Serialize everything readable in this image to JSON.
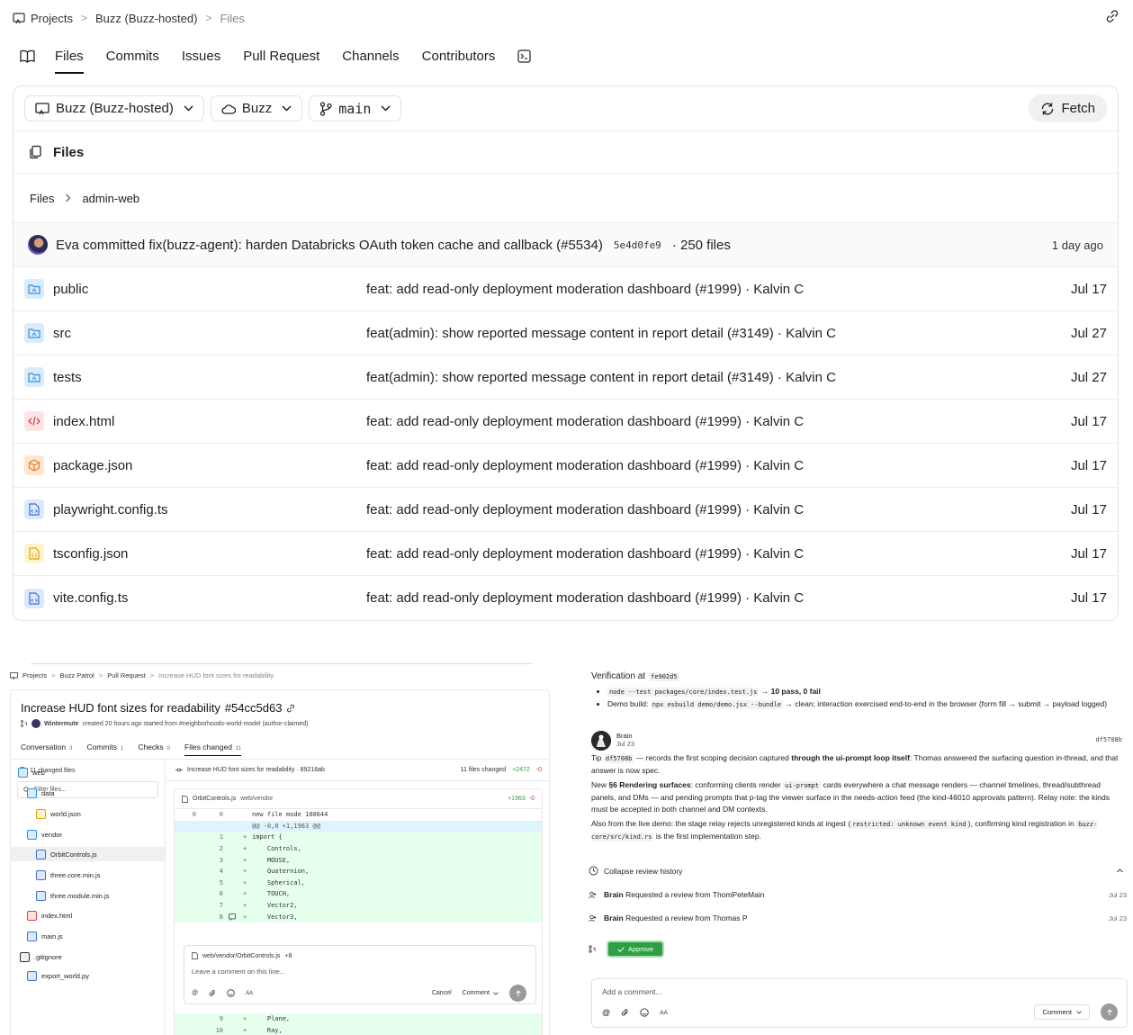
{
  "breadcrumb": {
    "projects": "Projects",
    "repo": "Buzz (Buzz-hosted)",
    "current": "Files"
  },
  "tabs": [
    "Files",
    "Commits",
    "Issues",
    "Pull Request",
    "Channels",
    "Contributors"
  ],
  "toolbar": {
    "repo": "Buzz (Buzz-hosted)",
    "remote": "Buzz",
    "branch": "main",
    "fetch": "Fetch"
  },
  "files_header": "Files",
  "path": {
    "root": "Files",
    "dir": "admin-web"
  },
  "commit": {
    "author": "Eva",
    "message": "committed fix(buzz-agent): harden Databricks OAuth token cache and callback (#5534)",
    "hash": "5e4d0fe9",
    "files": "· 250 files",
    "when": "1 day ago"
  },
  "files": [
    {
      "name": "public",
      "message": "feat: add read-only deployment moderation dashboard (#1999) · Kalvin C",
      "date": "Jul 17",
      "icon": "folder-icon"
    },
    {
      "name": "src",
      "message": "feat(admin): show reported message content in report detail (#3149) · Kalvin C",
      "date": "Jul 27",
      "icon": "folder-icon"
    },
    {
      "name": "tests",
      "message": "feat(admin): show reported message content in report detail (#3149) · Kalvin C",
      "date": "Jul 27",
      "icon": "folder-icon"
    },
    {
      "name": "index.html",
      "message": "feat: add read-only deployment moderation dashboard (#1999) · Kalvin C",
      "date": "Jul 17",
      "icon": "code-icon"
    },
    {
      "name": "package.json",
      "message": "feat: add read-only deployment moderation dashboard (#1999) · Kalvin C",
      "date": "Jul 17",
      "icon": "package-icon"
    },
    {
      "name": "playwright.config.ts",
      "message": "feat: add read-only deployment moderation dashboard (#1999) · Kalvin C",
      "date": "Jul 17",
      "icon": "ts-file-icon"
    },
    {
      "name": "tsconfig.json",
      "message": "feat: add read-only deployment moderation dashboard (#1999) · Kalvin C",
      "date": "Jul 17",
      "icon": "json-file-icon"
    },
    {
      "name": "vite.config.ts",
      "message": "feat: add read-only deployment moderation dashboard (#1999) · Kalvin C",
      "date": "Jul 17",
      "icon": "ts-file-icon"
    }
  ],
  "pr": {
    "crumb": [
      "Projects",
      "Buzz Patrol",
      "Pull Request",
      "Increase HUD font sizes for readability"
    ],
    "title": "Increase HUD font sizes for readability",
    "hash": "#54cc5d63",
    "author": "Wintermute",
    "created": "created 20 hours ago started from #neighborhoods-world-model (author-claimed)",
    "tabs": [
      {
        "label": "Conversation",
        "count": "3"
      },
      {
        "label": "Commits",
        "count": "1"
      },
      {
        "label": "Checks",
        "count": "0"
      },
      {
        "label": "Files changed",
        "count": "11"
      }
    ],
    "changed_files": "11 changed files",
    "filter_placeholder": "Filter files...",
    "tree": [
      "web",
      "data",
      "world.json",
      "vendor",
      "OrbitControls.js",
      "three.core.min.js",
      "three.module.min.js",
      "index.html",
      "main.js",
      ".gitignore",
      "export_world.py"
    ],
    "diff_commit": "Increase HUD font sizes for readability · 89218ab",
    "diff_stats": {
      "files": "11 files changed",
      "add": "+2472",
      "del": "-0"
    },
    "file": {
      "name": "OrbitControls.js",
      "dir": "web/vendor",
      "add": "+1963",
      "del": "-0"
    },
    "meta_lines": [
      "new file mode 100644",
      "@@ -0,0 +1,1963 @@"
    ],
    "lines": [
      {
        "n": "1",
        "code": "import {"
      },
      {
        "n": "2",
        "code": "    Controls,"
      },
      {
        "n": "3",
        "code": "    MOUSE,"
      },
      {
        "n": "4",
        "code": "    Quaternion,"
      },
      {
        "n": "5",
        "code": "    Spherical,"
      },
      {
        "n": "6",
        "code": "    TOUCH,"
      },
      {
        "n": "7",
        "code": "    Vector2,"
      },
      {
        "n": "8",
        "code": "    Vector3,"
      }
    ],
    "lines_after": [
      {
        "n": "9",
        "code": "    Plane,"
      },
      {
        "n": "10",
        "code": "    Ray,"
      }
    ],
    "zero": "0",
    "comment": {
      "file": "web/vendor/OrbitControls.js",
      "line": "+8",
      "placeholder": "Leave a comment on this line...",
      "cancel": "Cancel",
      "submit": "Comment",
      "aa": "AA"
    }
  },
  "review": {
    "verification_label": "Verification at",
    "verification_hash": "fe902d5",
    "bullet1_code": "node --test packages/core/index.test.js",
    "bullet1_result": "→ 10 pass, 0 fail",
    "bullet2_pre": "Demo build:",
    "bullet2_code": "npx esbuild demo/demo.jsx --bundle",
    "bullet2_rest": "→ clean; interaction exercised end-to-end in the browser (form fill → submit → payload logged)",
    "brain_name": "Brain",
    "brain_date": "Jul 23",
    "brain_hash": "df5708b",
    "p1_pre": "Tip",
    "p1_code": "df5708b",
    "p1_mid": "— records the first scoping decision captured",
    "p1_bold": "through the ui-prompt loop itself",
    "p1_rest": ": Thomas answered the surfacing question in-thread, and that answer is now spec.",
    "p2_pre": "New",
    "p2_bold": "§6 Rendering surfaces",
    "p2_mid": ": conforming clients render",
    "p2_code": "ui-prompt",
    "p2_rest": "cards everywhere a chat message renders — channel timelines, thread/subthread panels, and DMs — and pending prompts that p-tag the viewer surface in the needs-action feed (the kind-46010 approvals pattern). Relay note: the kinds must be accepted in both channel and DM contexts.",
    "p3_pre": "Also from the live demo: the stage relay rejects unregistered kinds at ingest (",
    "p3_code": "restricted: unknown event kind",
    "p3_mid": "), confirming kind registration in",
    "p3_code2": "buzz-core/src/kind.rs",
    "p3_rest": "is the first implementation step.",
    "collapse": "Collapse review history",
    "requests": [
      {
        "actor": "Brain",
        "text": "Requested a review from ThomPeteMain",
        "date": "Jul 23"
      },
      {
        "actor": "Brain",
        "text": "Requested a review from Thomas P",
        "date": "Jul 23"
      }
    ],
    "approve": "Approve",
    "comment_placeholder": "Add a comment...",
    "comment_submit": "Comment",
    "aa": "AA"
  }
}
